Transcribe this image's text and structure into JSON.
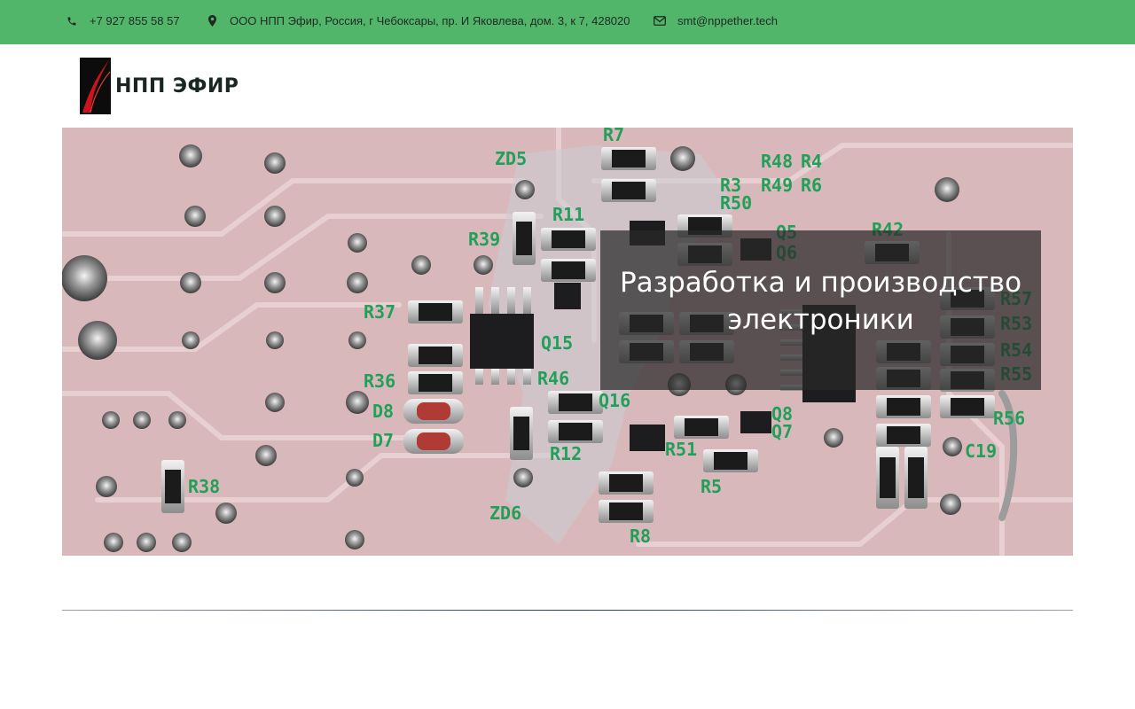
{
  "topbar": {
    "phone": "+7 927 855 58 57",
    "address": "ООО НПП Эфир, Россия, г Чебоксары, пр. И Яковлева, дом. 3, к 7, 428020",
    "email": "smt@nppether.tech",
    "phone_icon": "phone-icon",
    "address_icon": "map-marker-icon",
    "email_icon": "envelope-icon",
    "background_color": "#51b66a"
  },
  "header": {
    "logo_text": "НПП ЭФИР"
  },
  "hero": {
    "caption": "Разработка и производство электроники",
    "image": "printed-circuit-board-photo"
  }
}
